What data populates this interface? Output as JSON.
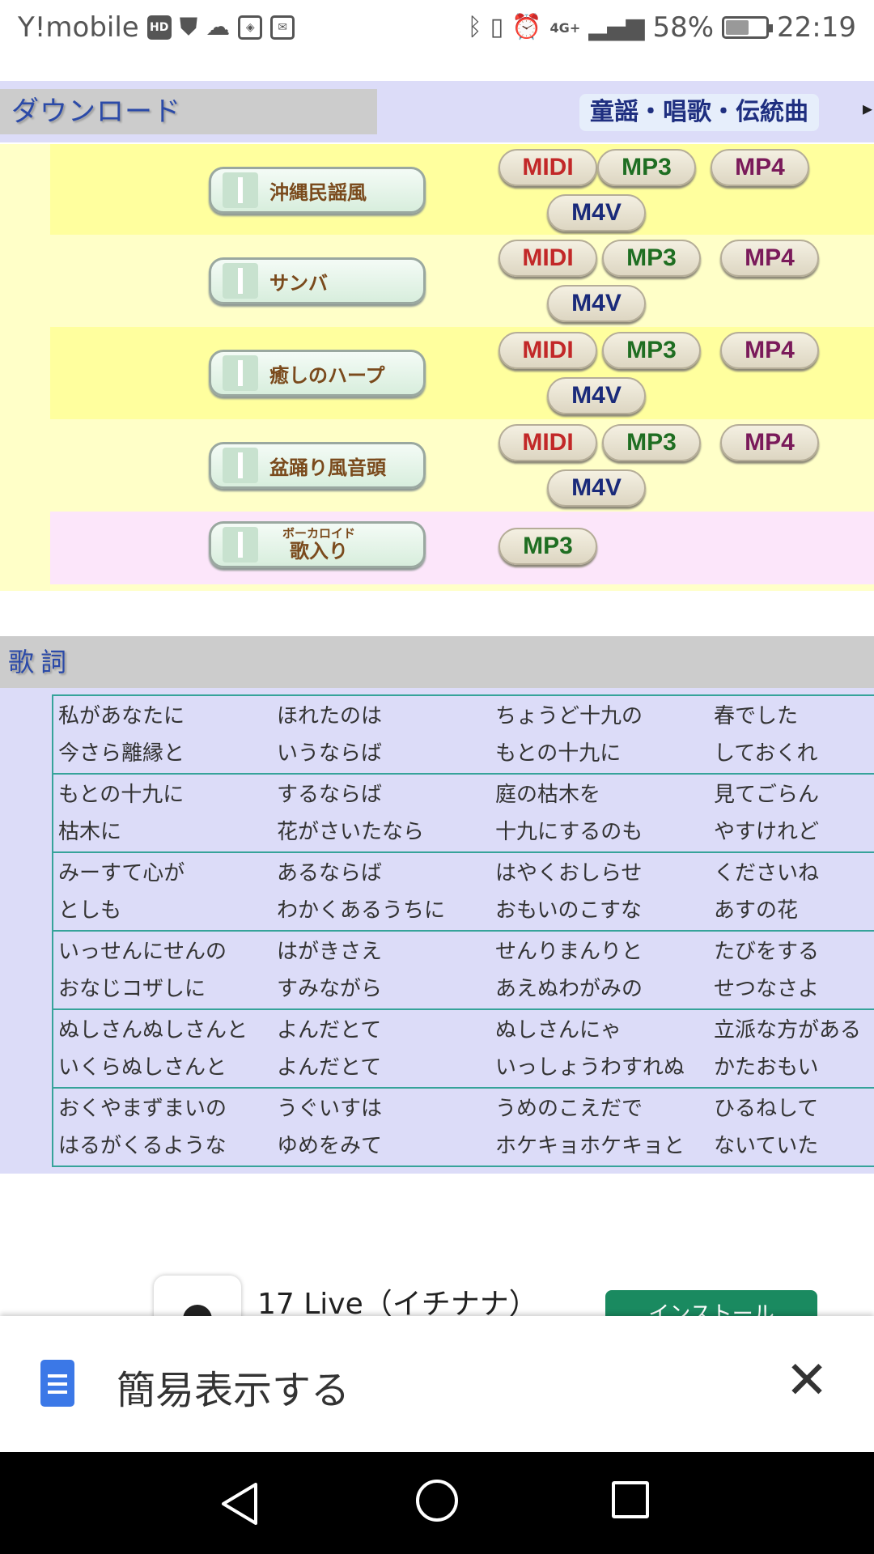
{
  "status_bar": {
    "carrier": "Y!mobile",
    "hd_badge": "HD",
    "network": "4G+",
    "battery_percent": "58%",
    "battery_level": 0.58,
    "time": "22:19",
    "icons": [
      "shield-icon",
      "cloud-icon",
      "app-icon",
      "mail-icon",
      "bluetooth-icon",
      "vibrate-icon",
      "alarm-icon",
      "signal-icon",
      "battery-icon"
    ]
  },
  "download": {
    "title": "ダウンロード",
    "category_tab": "童謡・唱歌・伝統曲",
    "rows": [
      {
        "style": "沖縄民謡風",
        "icon": "sanshin-icon",
        "formats": [
          "MIDI",
          "MP3",
          "MP4",
          "M4V"
        ]
      },
      {
        "style": "サンバ",
        "icon": "maracas-icon",
        "formats": [
          "MIDI",
          "MP3",
          "MP4",
          "M4V"
        ]
      },
      {
        "style": "癒しのハープ",
        "icon": "harp-icon",
        "formats": [
          "MIDI",
          "MP3",
          "MP4",
          "M4V"
        ]
      },
      {
        "style": "盆踊り風音頭",
        "icon": "sanshin-icon",
        "formats": [
          "MIDI",
          "MP3",
          "MP4",
          "M4V"
        ]
      },
      {
        "style_small": "ボーカロイド",
        "style": "歌入り",
        "icon": "lips-icon",
        "formats": [
          "MP3"
        ]
      }
    ],
    "colors": {
      "yellow": "#ffff9e",
      "pale_yellow": "#ffffc8",
      "pink": "#fce6fa"
    }
  },
  "lyrics": {
    "title": "歌詞",
    "blocks": [
      [
        [
          "私があなたに",
          "ほれたのは",
          "ちょうど十九の",
          "春でした"
        ],
        [
          "今さら離縁と",
          "いうならば",
          "もとの十九に",
          "しておくれ"
        ]
      ],
      [
        [
          "もとの十九に",
          "するならば",
          "庭の枯木を",
          "見てごらん"
        ],
        [
          "枯木に",
          "花がさいたなら",
          "十九にするのも",
          "やすけれど"
        ]
      ],
      [
        [
          "みーすて心が",
          "あるならば",
          "はやくおしらせ",
          "くださいね"
        ],
        [
          "としも",
          "わかくあるうちに",
          "おもいのこすな",
          "あすの花"
        ]
      ],
      [
        [
          "いっせんにせんの",
          "はがきさえ",
          "せんりまんりと",
          "たびをする"
        ],
        [
          "おなじコザしに",
          "すみながら",
          "あえぬわがみの",
          "せつなさよ"
        ]
      ],
      [
        [
          "ぬしさんぬしさんと",
          "よんだとて",
          "ぬしさんにゃ",
          "立派な方がある"
        ],
        [
          "いくらぬしさんと",
          "よんだとて",
          "いっしょうわすれぬ",
          "かたおもい"
        ]
      ],
      [
        [
          "おくやまずまいの",
          "うぐいすは",
          "うめのこえだで",
          "ひるねして"
        ],
        [
          "はるがくるような",
          "ゆめをみて",
          "ホケキョホケキョと",
          "ないていた"
        ]
      ]
    ]
  },
  "ad": {
    "app_name": "17 Live（イチナナ）",
    "install_label": "インストール"
  },
  "simple_view": {
    "label": "簡易表示する",
    "close_glyph": "✕"
  }
}
